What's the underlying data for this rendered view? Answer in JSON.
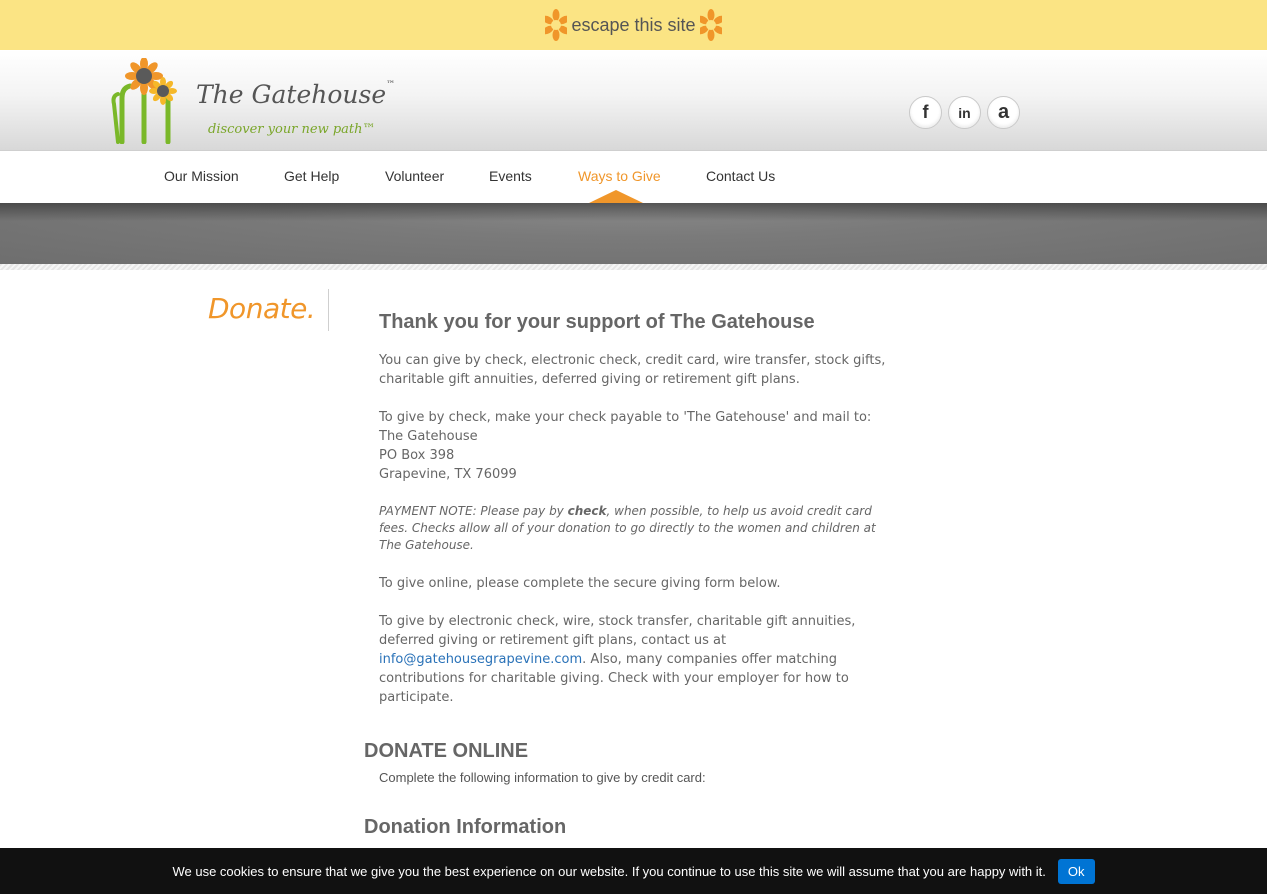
{
  "escape": {
    "label": "escape this site"
  },
  "logo": {
    "title": "The Gatehouse",
    "trademark": "™",
    "tagline": "discover your new path™"
  },
  "social": [
    {
      "name": "facebook",
      "glyph": "f"
    },
    {
      "name": "linkedin",
      "glyph": "in"
    },
    {
      "name": "amazon",
      "glyph": "a"
    }
  ],
  "nav": {
    "items": [
      "Our Mission",
      "Get Help",
      "Volunteer",
      "Events",
      "Ways to Give",
      "Contact Us"
    ],
    "active": "Ways to Give"
  },
  "sidebar": {
    "title": "Donate."
  },
  "content": {
    "heading": "Thank you for your support of The Gatehouse",
    "p1": "You can give by check, electronic check, credit card, wire transfer, stock gifts, charitable gift annuities, deferred giving or retirement gift plans.",
    "check_intro": "To give by check, make your check payable to 'The Gatehouse' and mail to:",
    "address_line1": "The Gatehouse",
    "address_line2": "PO Box 398",
    "address_line3": "Grapevine, TX 76099",
    "note_prefix": "PAYMENT NOTE: Please pay by ",
    "note_bold": "check",
    "note_suffix": ", when possible, to help us avoid credit card fees. Checks allow all of your donation to go directly to the women and children at The Gatehouse.",
    "p_online": "To give online, please complete the secure giving form below.",
    "p_other_prefix": "To give by electronic check, wire, stock transfer, charitable gift annuities, deferred giving or retirement gift plans, contact us at ",
    "email": "info@gatehousegrapevine.com",
    "p_other_suffix": ". Also, many companies offer matching contributions for charitable giving. Check with your employer for how to participate."
  },
  "donate_online": {
    "heading": "DONATE ONLINE",
    "subtext": "Complete the following information to give by credit card:"
  },
  "donation_info": {
    "heading": "Donation Information"
  },
  "cookie": {
    "text": "We use cookies to ensure that we give you the best experience on our website. If you continue to use this site we will assume that you are happy with it.",
    "ok_label": "Ok"
  },
  "colors": {
    "accent": "#f0962a",
    "escape_bar": "#fbe484",
    "link": "#2a72b8",
    "cookie_button": "#0074d4"
  }
}
